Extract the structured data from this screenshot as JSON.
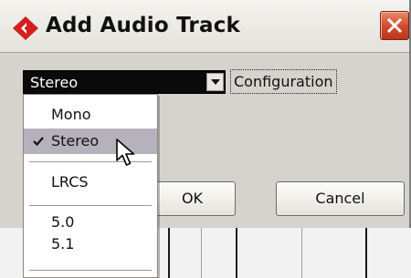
{
  "window": {
    "title": "Add Audio Track"
  },
  "configuration": {
    "selected_value": "Stereo",
    "label": "Configuration"
  },
  "buttons": {
    "ok": "OK",
    "cancel": "Cancel"
  },
  "dropdown": {
    "items": [
      {
        "label": "Mono",
        "checked": false
      },
      {
        "label": "Stereo",
        "checked": true
      },
      {
        "label": "LRCS",
        "checked": false
      },
      {
        "label": "5.0",
        "checked": false
      },
      {
        "label": "5.1",
        "checked": false
      }
    ]
  },
  "icons": {
    "app": "app-logo-icon",
    "close": "close-icon",
    "dropdown_arrow": "chevron-down-icon",
    "check": "checkmark-icon",
    "cursor": "mouse-pointer-icon"
  },
  "colors": {
    "dialog_bg": "#d6d3ce",
    "close_button": "#cf4a2c",
    "app_logo": "#d21f1f",
    "selected_item": "#b5b1bd"
  }
}
